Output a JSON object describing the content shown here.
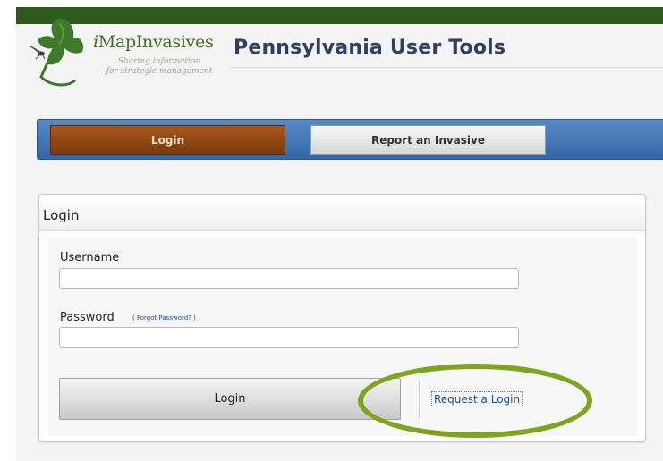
{
  "header": {
    "logo_text_prefix": "i",
    "logo_text_main": "MapInvasives",
    "logo_tagline_line1": "Sharing information",
    "logo_tagline_line2": "for strategic management",
    "page_title": "Pennsylvania User Tools",
    "brand_color": "#2f5a1e"
  },
  "nav": {
    "tabs": [
      {
        "label": "Login",
        "active": true
      },
      {
        "label": "Report an Invasive",
        "active": false
      }
    ],
    "bar_color": "#3466a8",
    "active_color": "#8b4513"
  },
  "login_panel": {
    "title": "Login",
    "username_label": "Username",
    "username_value": "",
    "password_label": "Password",
    "password_value": "",
    "forgot_open": "( ",
    "forgot_link": "Forgot Password?",
    "forgot_close": " )",
    "submit_label": "Login",
    "request_link": "Request a Login"
  },
  "annotation": {
    "highlight_color": "#7ea51e"
  }
}
